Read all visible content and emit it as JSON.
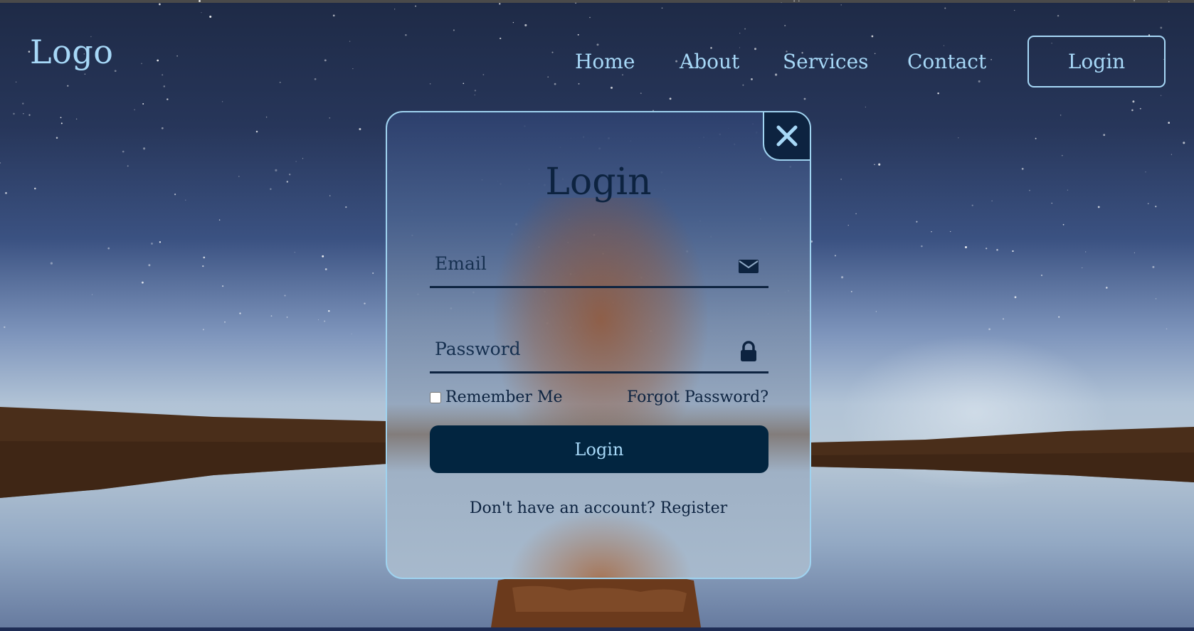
{
  "header": {
    "logo": "Logo",
    "nav": [
      "Home",
      "About",
      "Services",
      "Contact"
    ],
    "login_button": "Login"
  },
  "modal": {
    "title": "Login",
    "email": {
      "placeholder": "Email",
      "value": "",
      "icon": "envelope-icon"
    },
    "password": {
      "placeholder": "Password",
      "value": "",
      "icon": "lock-icon"
    },
    "remember_label": "Remember Me",
    "remember_checked": false,
    "forgot_label": "Forgot Password?",
    "submit_label": "Login",
    "register_prompt": "Don't have an account?",
    "register_link": "Register",
    "close_icon": "close-icon"
  },
  "colors": {
    "accent": "#a7d8f7",
    "dark_navy": "#0d2340",
    "button_bg": "#022540",
    "modal_border": "#9fd3f0"
  }
}
